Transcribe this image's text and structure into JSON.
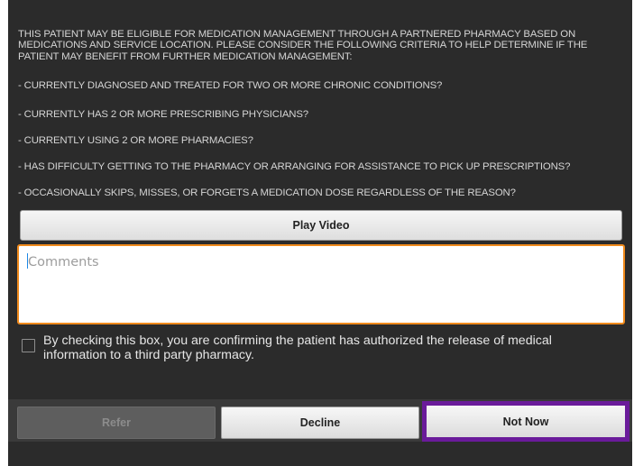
{
  "intro": {
    "text": "THIS PATIENT MAY BE ELIGIBLE FOR MEDICATION MANAGEMENT THROUGH A PARTNERED PHARMACY BASED ON MEDICATIONS AND SERVICE LOCATION. PLEASE CONSIDER THE FOLLOWING CRITERIA TO HELP DETERMINE IF THE PATIENT MAY BENEFIT FROM FURTHER MEDICATION MANAGEMENT:"
  },
  "criteria": [
    "- CURRENTLY DIAGNOSED AND TREATED FOR TWO OR MORE CHRONIC CONDITIONS?",
    "- CURRENTLY HAS 2 OR MORE PRESCRIBING PHYSICIANS?",
    "- CURRENTLY USING 2 OR MORE PHARMACIES?",
    "- HAS DIFFICULTY GETTING TO THE PHARMACY OR ARRANGING FOR ASSISTANCE TO PICK UP PRESCRIPTIONS?",
    "- OCCASIONALLY SKIPS, MISSES, OR FORGETS A MEDICATION DOSE REGARDLESS OF THE REASON?"
  ],
  "play_video": {
    "label": "Play Video"
  },
  "comments": {
    "placeholder": "Comments",
    "value": ""
  },
  "consent": {
    "checked": false,
    "label": "By checking this box, you are confirming the patient has authorized the release of medical information to a third party pharmacy."
  },
  "actions": {
    "refer_label": "Refer",
    "refer_enabled": false,
    "decline_label": "Decline",
    "not_now_label": "Not Now"
  },
  "colors": {
    "background": "#2b2b2b",
    "focus_border": "#f08a1c",
    "selected_highlight": "#6a1b9a"
  }
}
